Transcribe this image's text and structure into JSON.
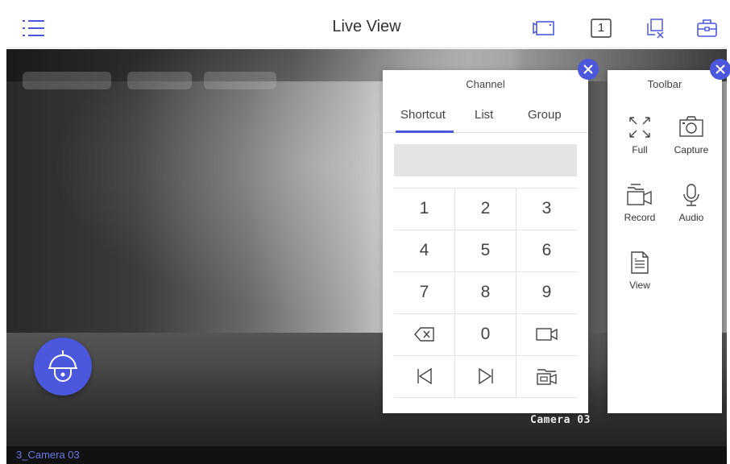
{
  "header": {
    "title": "Live View",
    "layout_count": "1"
  },
  "video": {
    "osd_camera": "Camera 03",
    "channel_label": "3_Camera 03"
  },
  "channel_panel": {
    "title": "Channel",
    "tabs": [
      "Shortcut",
      "List",
      "Group"
    ],
    "active_tab": "Shortcut",
    "input_value": "",
    "keys": [
      "1",
      "2",
      "3",
      "4",
      "5",
      "6",
      "7",
      "8",
      "9",
      "0"
    ]
  },
  "toolbar_panel": {
    "title": "Toolbar",
    "tools": [
      {
        "label": "Full",
        "icon": "fullscreen-icon"
      },
      {
        "label": "Capture",
        "icon": "camera-icon"
      },
      {
        "label": "Record",
        "icon": "record-icon"
      },
      {
        "label": "Audio",
        "icon": "microphone-icon"
      },
      {
        "label": "View",
        "icon": "document-icon"
      }
    ]
  },
  "colors": {
    "accent": "#4b58dd",
    "channel_label": "#6a78ea"
  }
}
